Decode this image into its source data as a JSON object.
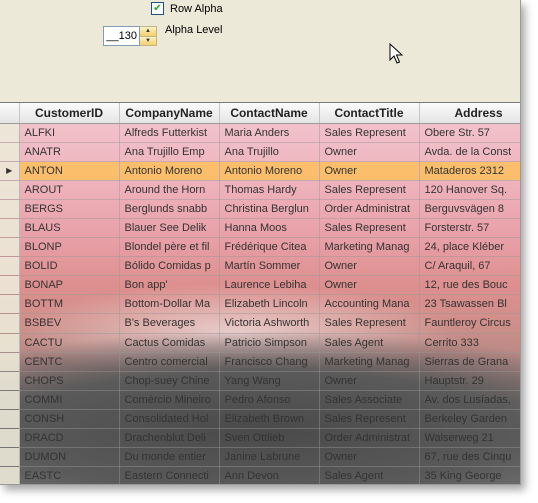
{
  "settings": {
    "row_alpha_checked": true,
    "row_alpha_label": "Row Alpha",
    "alpha_level_value": "__130",
    "alpha_level_label": "Alpha Level"
  },
  "grid": {
    "columns": [
      "CustomerID",
      "CompanyName",
      "ContactName",
      "ContactTitle",
      "Address"
    ],
    "selected_row_index": 2,
    "rows": [
      [
        "ALFKI",
        "Alfreds Futterkist",
        "Maria Anders",
        "Sales Represent",
        "Obere Str. 57"
      ],
      [
        "ANATR",
        "Ana Trujillo Emp",
        "Ana Trujillo",
        "Owner",
        "Avda. de la Const"
      ],
      [
        "ANTON",
        "Antonio Moreno",
        "Antonio Moreno",
        "Owner",
        "Mataderos  2312"
      ],
      [
        "AROUT",
        "Around the Horn",
        "Thomas Hardy",
        "Sales Represent",
        "120 Hanover Sq."
      ],
      [
        "BERGS",
        "Berglunds snabb",
        "Christina Berglun",
        "Order Administrat",
        "Berguvsvägen  8"
      ],
      [
        "BLAUS",
        "Blauer See Delik",
        "Hanna Moos",
        "Sales Represent",
        "Forsterstr. 57"
      ],
      [
        "BLONP",
        "Blondel père et fil",
        "Frédérique Citea",
        "Marketing Manag",
        "24, place Kléber"
      ],
      [
        "BOLID",
        "Bólido Comidas p",
        "Martín Sommer",
        "Owner",
        "C/ Araquil, 67"
      ],
      [
        "BONAP",
        "Bon app'",
        "Laurence Lebiha",
        "Owner",
        "12, rue des Bouc"
      ],
      [
        "BOTTM",
        "Bottom-Dollar Ma",
        "Elizabeth Lincoln",
        "Accounting Mana",
        "23 Tsawassen Bl"
      ],
      [
        "BSBEV",
        "B's Beverages",
        "Victoria Ashworth",
        "Sales Represent",
        "Fauntleroy Circus"
      ],
      [
        "CACTU",
        "Cactus Comidas",
        "Patricio Simpson",
        "Sales Agent",
        "Cerrito 333"
      ],
      [
        "CENTC",
        "Centro comercial",
        "Francisco Chang",
        "Marketing Manag",
        "Sierras de Grana"
      ],
      [
        "CHOPS",
        "Chop-suey Chine",
        "Yang Wang",
        "Owner",
        "Hauptstr. 29"
      ],
      [
        "COMMI",
        "Comércio Mineiro",
        "Pedro Afonso",
        "Sales Associate",
        "Av. dos Lusíadas,"
      ],
      [
        "CONSH",
        "Consolidated Hol",
        "Elizabeth Brown",
        "Sales Represent",
        "Berkeley Garden"
      ],
      [
        "DRACD",
        "Drachenblut Deli",
        "Sven Ottlieb",
        "Order Administrat",
        "Walserweg 21"
      ],
      [
        "DUMON",
        "Du monde entier",
        "Janine Labrune",
        "Owner",
        "67, rue des Cinqu"
      ],
      [
        "EASTC",
        "Eastern Connecti",
        "Ann Devon",
        "Sales Agent",
        "35 King George"
      ]
    ]
  },
  "icons": {
    "row_indicator": "current-row-arrow-icon",
    "check": "check-mark-icon",
    "cursor": "mouse-pointer-icon"
  },
  "colors": {
    "panel_bg": "#ECE9D8",
    "selected_row": "#FFC150",
    "row_tint": "#F0B4BE"
  }
}
